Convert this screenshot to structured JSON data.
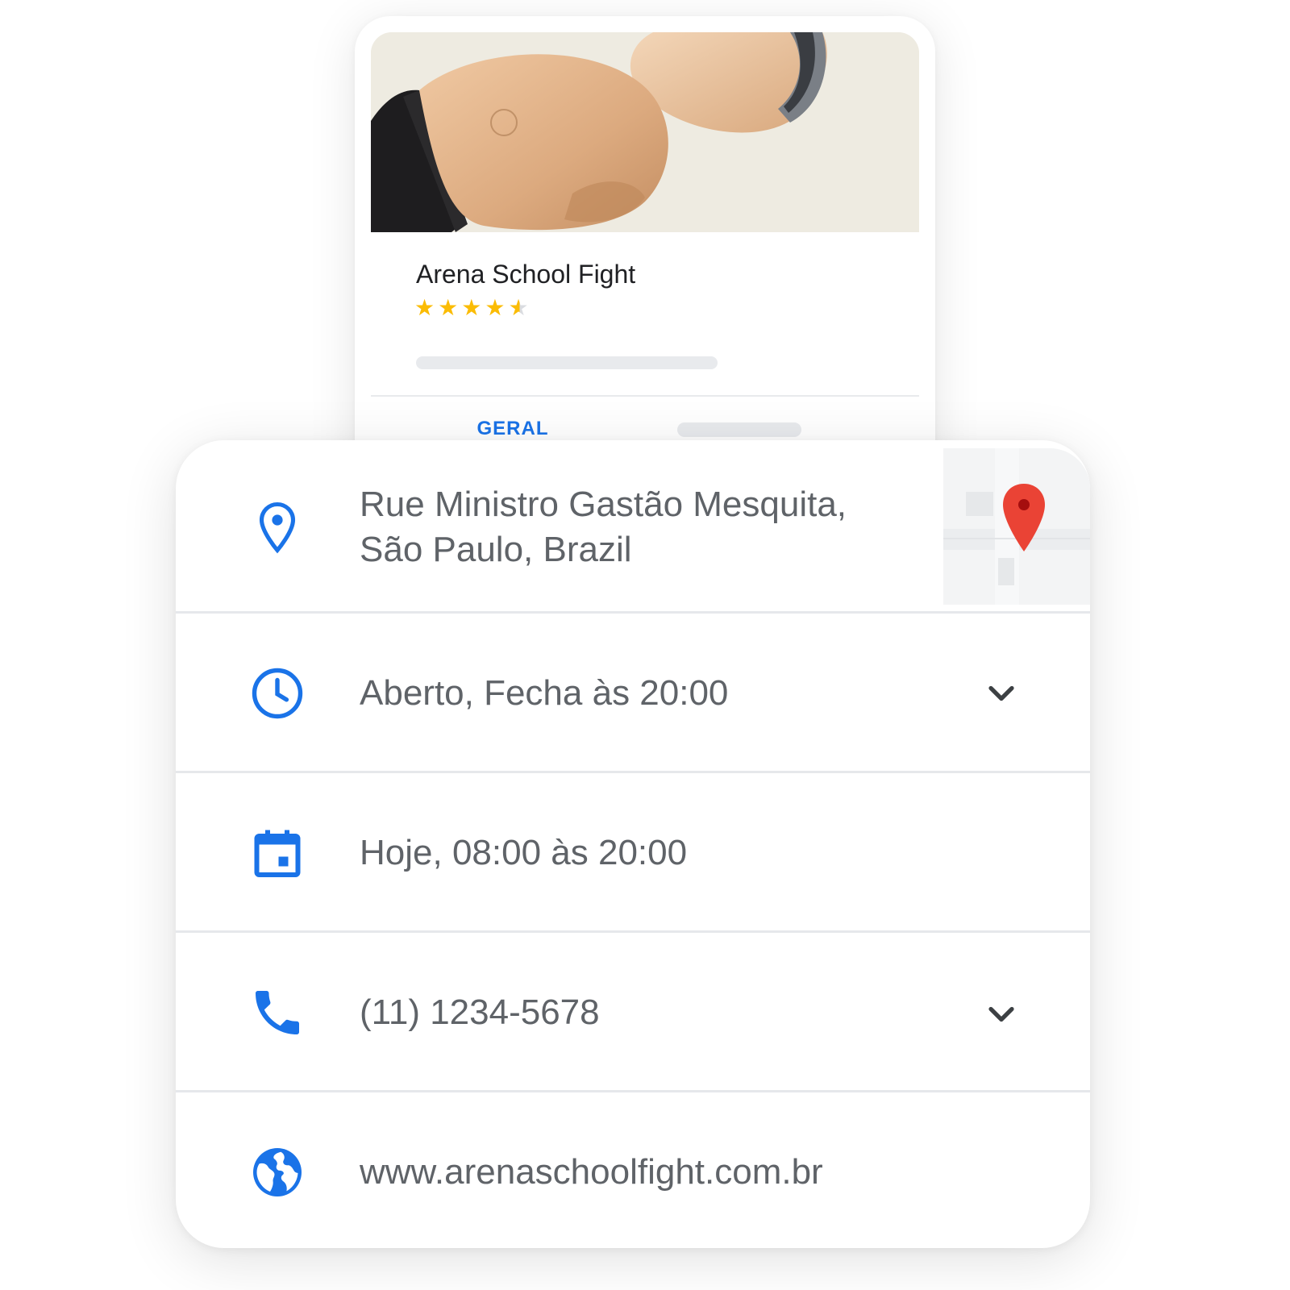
{
  "business": {
    "name": "Arena School Fight",
    "rating": 4.5,
    "rating_max": 5
  },
  "tabs": {
    "active_label": "GERAL"
  },
  "info": {
    "address_line1": "Rue Ministro Gastão Mesquita,",
    "address_line2": "São Paulo,  Brazil",
    "hours": "Aberto, Fecha às 20:00",
    "today": "Hoje, 08:00 às 20:00",
    "phone": "(11) 1234-5678",
    "website": "www.arenaschoolfight.com.br"
  },
  "icons": {
    "address": "location-pin-icon",
    "hours": "clock-icon",
    "today": "calendar-icon",
    "phone": "phone-icon",
    "website": "globe-icon",
    "expand": "chevron-down-icon",
    "map_marker": "map-marker-icon"
  },
  "colors": {
    "accent": "#1a73e8",
    "star": "#fbbc04",
    "text": "#5f6368",
    "title": "#202124",
    "map_pin": "#ea4335",
    "divider": "#e6e8eb"
  }
}
